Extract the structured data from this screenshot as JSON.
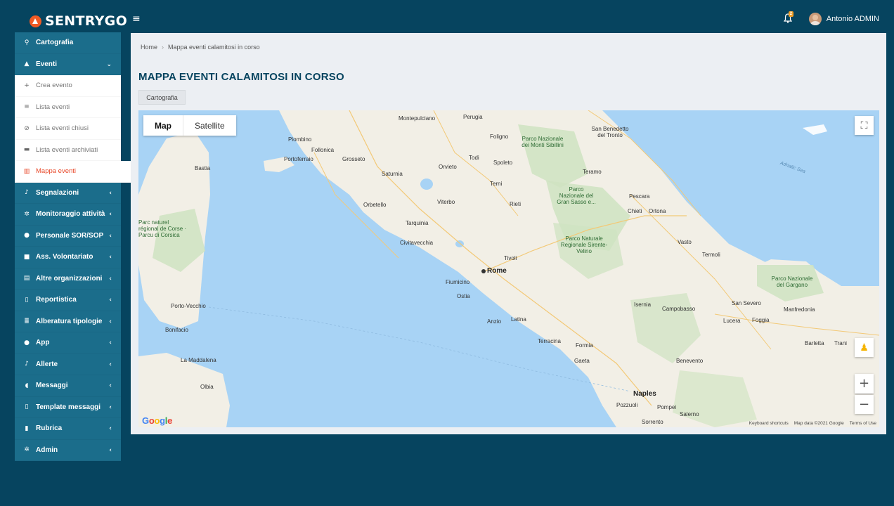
{
  "app": {
    "logo": "SENTRYGO"
  },
  "topbar": {
    "notification_count": "2",
    "user_name": "Antonio ADMIN"
  },
  "sidebar": {
    "items": [
      {
        "label": "Cartografia",
        "icon": "map-marker-icon",
        "glyph": "⚲"
      },
      {
        "label": "Eventi",
        "icon": "warning-icon",
        "glyph": "▲"
      },
      {
        "label": "Crea evento",
        "icon": "plus-icon",
        "glyph": "+"
      },
      {
        "label": "Lista eventi",
        "icon": "list-icon",
        "glyph": "≡"
      },
      {
        "label": "Lista eventi chiusi",
        "icon": "ban-icon",
        "glyph": "⊘"
      },
      {
        "label": "Lista eventi archiviati",
        "icon": "archive-icon",
        "glyph": "▬"
      },
      {
        "label": "Mappa eventi",
        "icon": "map-icon",
        "glyph": "▥"
      },
      {
        "label": "Segnalazioni",
        "icon": "bell-icon",
        "glyph": "♪"
      },
      {
        "label": "Monitoraggio attività",
        "icon": "gear-icon",
        "glyph": "✲"
      },
      {
        "label": "Personale SOR/SOP",
        "icon": "user-icon",
        "glyph": "●"
      },
      {
        "label": "Ass. Volontariato",
        "icon": "truck-icon",
        "glyph": "■"
      },
      {
        "label": "Altre organizzazioni",
        "icon": "building-icon",
        "glyph": "▤"
      },
      {
        "label": "Reportistica",
        "icon": "file-icon",
        "glyph": "▯"
      },
      {
        "label": "Alberatura tipologie",
        "icon": "list-icon",
        "glyph": "≣"
      },
      {
        "label": "App",
        "icon": "user-icon",
        "glyph": "●"
      },
      {
        "label": "Allerte",
        "icon": "bell-icon",
        "glyph": "♪"
      },
      {
        "label": "Messaggi",
        "icon": "comments-icon",
        "glyph": "◖"
      },
      {
        "label": "Template messaggi",
        "icon": "file-icon",
        "glyph": "▯"
      },
      {
        "label": "Rubrica",
        "icon": "address-book-icon",
        "glyph": "▮"
      },
      {
        "label": "Admin",
        "icon": "gears-icon",
        "glyph": "✲"
      }
    ]
  },
  "breadcrumb": {
    "home": "Home",
    "current": "Mappa eventi calamitosi in corso"
  },
  "page": {
    "title": "MAPPA EVENTI CALAMITOSI IN CORSO",
    "tab": "Cartografia"
  },
  "map": {
    "type_map": "Map",
    "type_satellite": "Satellite",
    "google": "Google",
    "attribution": [
      "Keyboard shortcuts",
      "Map data ©2021 Google",
      "Terms of Use"
    ],
    "labels": {
      "rome": "Rome",
      "naples": "Naples",
      "bastia": "Bastia",
      "corsica": "Parc naturel régional de Corse · Parcu di Corsica",
      "perugia": "Perugia",
      "montepulciano": "Montepulciano",
      "foligno": "Foligno",
      "spoleto": "Spoleto",
      "terni": "Terni",
      "rieti": "Rieti",
      "viterbo": "Viterbo",
      "tarquinia": "Tarquinia",
      "civitavecchia": "Civitavecchia",
      "tivoli": "Tivoli",
      "fiumicino": "Fiumicino",
      "ostia": "Ostia",
      "anzio": "Anzio",
      "latina": "Latina",
      "terracina": "Terracina",
      "formia": "Formia",
      "gaeta": "Gaeta",
      "pozzuoli": "Pozzuoli",
      "pompei": "Pompei",
      "sorrento": "Sorrento",
      "salerno": "Salerno",
      "benevento": "Benevento",
      "campobasso": "Campobasso",
      "isernia": "Isernia",
      "foggia": "Foggia",
      "lucera": "Lucera",
      "barletta": "Barletta",
      "trani": "Trani",
      "manfredonia": "Manfredonia",
      "san_severo": "San Severo",
      "vasto": "Vasto",
      "termoli": "Termoli",
      "chieti": "Chieti",
      "ortona": "Ortona",
      "pescara": "Pescara",
      "teramo": "Teramo",
      "sbt": "San Benedetto del Tronto",
      "grosseto": "Grosseto",
      "follonica": "Follonica",
      "piombino": "Piombino",
      "portoferraio": "Portoferraio",
      "orbetello": "Orbetello",
      "orvieto": "Orvieto",
      "todi": "Todi",
      "saturnia": "Saturnia",
      "olbia": "Olbia",
      "la_maddalena": "La Maddalena",
      "bonifacio": "Bonifacio",
      "porto_vecchio": "Porto-Vecchio",
      "sibillini": "Parco Nazionale dei Monti Sibillini",
      "gran_sasso": "Parco Nazionale del Gran Sasso e...",
      "sirente": "Parco Naturale Regionale Sirente-Velino",
      "gargano": "Parco Nazionale del Gargano",
      "adriatic": "Adriatic Sea"
    }
  },
  "colors": {
    "bg": "#06445f",
    "sidebar": "#1b6d8b",
    "active": "#e8492a",
    "accent": "#f15a24",
    "sea": "#a8d3f5",
    "land": "#f2efe6",
    "park": "#cfe3c1"
  }
}
